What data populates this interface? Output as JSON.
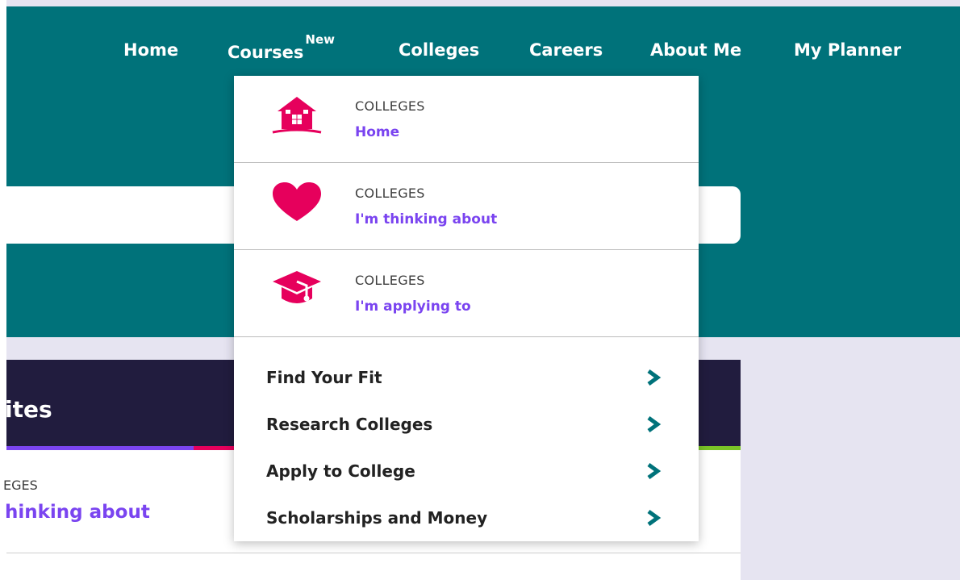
{
  "nav": {
    "items": [
      {
        "label": "Home"
      },
      {
        "label": "Courses",
        "badge": "New"
      },
      {
        "label": "Colleges"
      },
      {
        "label": "Careers"
      },
      {
        "label": "About Me"
      },
      {
        "label": "My Planner"
      }
    ]
  },
  "dropdown": {
    "cards": [
      {
        "category": "COLLEGES",
        "label": "Home",
        "icon": "house-icon"
      },
      {
        "category": "COLLEGES",
        "label": "I'm thinking about",
        "icon": "heart-icon"
      },
      {
        "category": "COLLEGES",
        "label": "I'm applying to",
        "icon": "graduation-cap-icon"
      }
    ],
    "links": [
      {
        "label": "Find Your Fit"
      },
      {
        "label": "Research Colleges"
      },
      {
        "label": "Apply to College"
      },
      {
        "label": "Scholarships and Money"
      }
    ]
  },
  "favorites": {
    "title_fragment": "ites",
    "category_fragment": "EGES",
    "link_fragment": "hinking about"
  },
  "colors": {
    "header_teal": "#00727a",
    "accent_pink": "#e6005c",
    "link_purple": "#7a44f0",
    "chevron_teal": "#00727a",
    "card_header_navy": "#211c3e"
  }
}
